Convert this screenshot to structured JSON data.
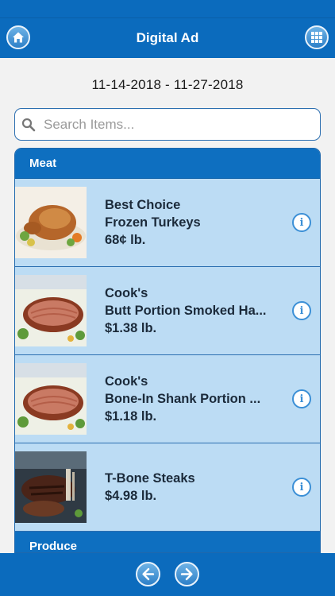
{
  "header": {
    "title": "Digital Ad",
    "home_icon": "home-icon",
    "menu_icon": "grid-menu-icon"
  },
  "date_range": "11-14-2018 - 11-27-2018",
  "search": {
    "placeholder": "Search Items...",
    "value": ""
  },
  "sections": [
    {
      "label": "Meat",
      "items": [
        {
          "line1": "Best Choice",
          "line2": "Frozen Turkeys",
          "price": "68¢ lb.",
          "image": "turkey"
        },
        {
          "line1": "Cook's",
          "line2": "Butt Portion Smoked Ha...",
          "price": "$1.38 lb.",
          "image": "ham"
        },
        {
          "line1": "Cook's",
          "line2": "Bone-In Shank Portion ...",
          "price": "$1.18 lb.",
          "image": "ham"
        },
        {
          "line1": "T-Bone Steaks",
          "line2": "",
          "price": "$4.98 lb.",
          "image": "steak"
        }
      ]
    },
    {
      "label": "Produce",
      "items": []
    }
  ],
  "footer": {
    "prev_icon": "arrow-left-icon",
    "next_icon": "arrow-right-icon"
  },
  "colors": {
    "brand": "#0b6bbd",
    "row_bg": "#bcdcf4",
    "info": "#3b8fd6"
  }
}
